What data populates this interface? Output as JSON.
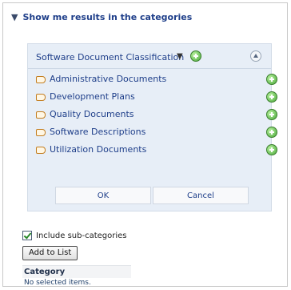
{
  "section": {
    "title": "Show me results in the categories"
  },
  "panel": {
    "title": "Software Document Classification",
    "items": [
      {
        "label": "Administrative Documents"
      },
      {
        "label": "Development Plans"
      },
      {
        "label": "Quality Documents"
      },
      {
        "label": "Software Descriptions"
      },
      {
        "label": "Utilization Documents"
      }
    ],
    "ok_label": "OK",
    "cancel_label": "Cancel"
  },
  "include": {
    "label": "Include sub-categories",
    "checked": true
  },
  "add_button": {
    "label": "Add to List"
  },
  "category_table": {
    "header": "Category",
    "empty_text": "No selected items."
  },
  "colors": {
    "link": "#1f3f8a",
    "panel_bg": "#e7eef7",
    "plus_green": "#4aa83a"
  },
  "icons": [
    "collapse-triangle-icon",
    "dropdown-caret-icon",
    "add-icon",
    "up-level-icon",
    "tag-icon",
    "checkbox-checked-icon"
  ]
}
